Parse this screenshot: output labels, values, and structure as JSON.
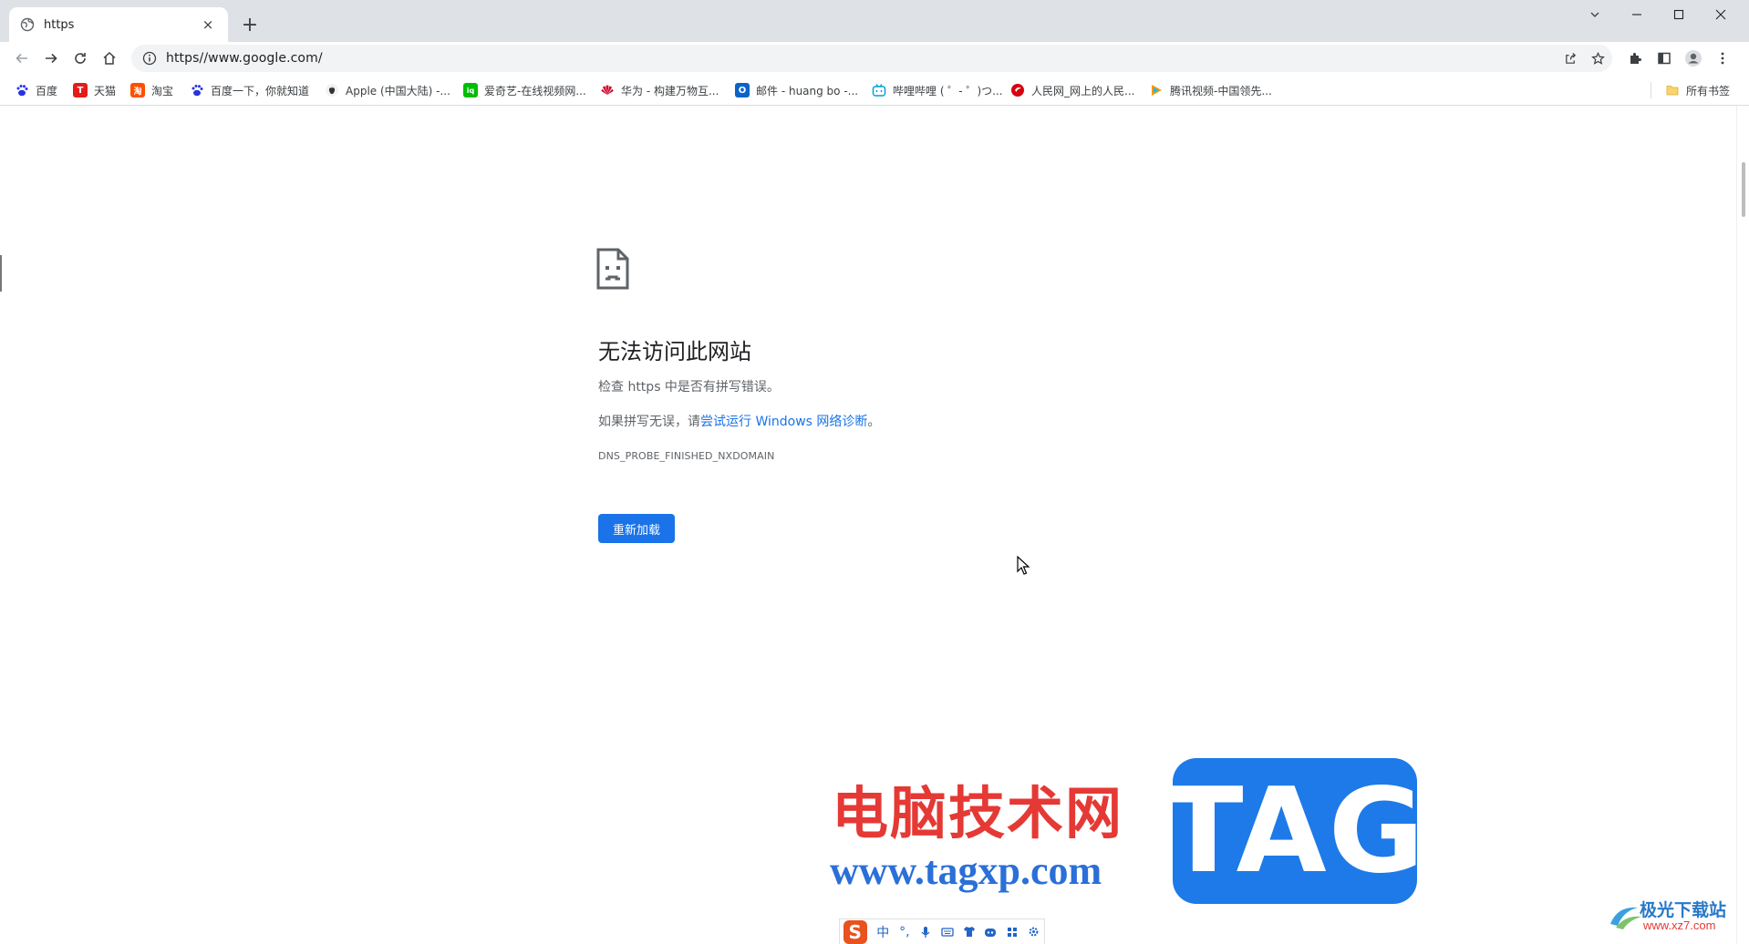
{
  "tab": {
    "title": "https",
    "close_glyph": "×",
    "new_tab_glyph": "+"
  },
  "window_controls": [
    "tab-search-icon",
    "minimize-icon",
    "maximize-icon",
    "close-icon"
  ],
  "toolbar": {
    "url": "https//www.google.com/"
  },
  "bookmarks": [
    {
      "label": "百度",
      "icon": "baidu-icon",
      "color": "#2932e1"
    },
    {
      "label": "天猫",
      "icon": "tmall-icon",
      "color": "#e31d1a",
      "glyph": "T"
    },
    {
      "label": "淘宝",
      "icon": "taobao-icon",
      "color": "#ff5000",
      "glyph": "淘"
    },
    {
      "label": "百度一下，你就知道",
      "icon": "baidu-icon",
      "color": "#2932e1"
    },
    {
      "label": "Apple (中国大陆) -...",
      "icon": "apple-icon",
      "color": "#333333"
    },
    {
      "label": "爱奇艺-在线视频网...",
      "icon": "iqiyi-icon",
      "color": "#00be06",
      "glyph": "iq"
    },
    {
      "label": "华为 - 构建万物互...",
      "icon": "huawei-icon",
      "color": "#cf0a2c"
    },
    {
      "label": "邮件 - huang bo -...",
      "icon": "outlook-icon",
      "color": "#0a64c8",
      "glyph": "O"
    },
    {
      "label": "哔哩哔哩 ( ゜- ゜)つ...",
      "icon": "bilibili-icon",
      "color": "#00a1d6"
    },
    {
      "label": "人民网_网上的人民...",
      "icon": "peoples-daily-icon",
      "color": "#d7000f"
    },
    {
      "label": "腾讯视频-中国领先...",
      "icon": "tencent-video-icon",
      "color": "#ff9900"
    }
  ],
  "all_bookmarks": "所有书签",
  "error": {
    "title": "无法访问此网站",
    "line1": "检查 https 中是否有拼写错误。",
    "line2_prefix": "如果拼写无误，请",
    "line2_link": "尝试运行 Windows 网络诊断",
    "line2_suffix": "。",
    "code": "DNS_PROBE_FINISHED_NXDOMAIN",
    "reload_label": "重新加载"
  },
  "watermark": {
    "cn": "电脑技术网",
    "url": "www.tagxp.com",
    "tag": "TAG",
    "xz_cn": "极光下载站",
    "xz_url": "www.xz7.com"
  },
  "ime": {
    "logo": "S",
    "mode": "中",
    "punct": "°,"
  },
  "colors": {
    "accent": "#1a73e8",
    "tabstrip": "#dee1e6",
    "omnibox": "#f1f3f4"
  }
}
